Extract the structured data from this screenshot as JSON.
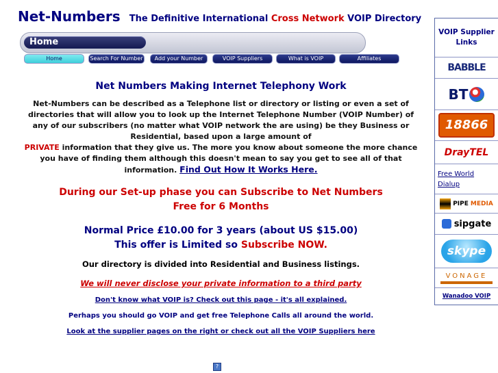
{
  "header": {
    "brand": "Net-Numbers",
    "tagline_part1": "The Definitive International",
    "tagline_red": "Cross Network",
    "tagline_part2": "VOIP Directory"
  },
  "homebar": {
    "label": "Home"
  },
  "nav": [
    {
      "label": "Home",
      "active": true
    },
    {
      "label": "Search For Number",
      "active": false
    },
    {
      "label": "Add your Number",
      "active": false
    },
    {
      "label": "VOIP Suppliers",
      "active": false
    },
    {
      "label": "What is VOIP",
      "active": false
    },
    {
      "label": "Affiliates",
      "active": false
    }
  ],
  "main": {
    "heading": "Net Numbers Making Internet Telephony Work",
    "intro_part1": "Net-Numbers can be described as a Telephone list or directory or listing or even a set of directories that will allow you to look up the Internet Telephone Number (VOIP Number) of any of our subscribers (no matter what VOIP network the are using) be they Business or Residential, based upon a large amount of",
    "intro_red": "PRIVATE",
    "intro_part2": "information that they give us. The more you know about someone the more chance you have of finding them although this doesn't mean to say you get to see all of that information.",
    "intro_link": "Find Out How It Works Here.",
    "setup_line1": "During our Set-up phase you can Subscribe to Net Numbers",
    "setup_line2": "Free for 6 Months",
    "price_line1": "Normal Price £10.00 for 3 years (about US $15.00)",
    "price_line2_part1": "This offer is Limited so",
    "price_line2_red": "Subscribe NOW.",
    "directory_text": "Our directory is divided into Residential and Business listings.",
    "privacy_text": "We will never disclose your private information to a third party",
    "voip_link": "Don't know what VOIP is? Check out this page - it's all explained.",
    "free_calls_text": "Perhaps you should go VOIP and get free Telephone Calls all around the world.",
    "suppliers_link": "Look at the supplier pages on the right or check out all the VOIP Suppliers here"
  },
  "sidebar": {
    "title": "VOIP Supplier Links",
    "items": [
      {
        "name": "babble",
        "text": "BABBLE"
      },
      {
        "name": "bt",
        "text": "BT"
      },
      {
        "name": "18866",
        "text": "18866"
      },
      {
        "name": "draytel",
        "text": "DrayTEL"
      },
      {
        "name": "free-world-dialup",
        "text": "Free World Dialup"
      },
      {
        "name": "pipemedia",
        "text_part1": "PIPE",
        "text_part2": "MEDIA"
      },
      {
        "name": "sipgate",
        "text": "sipgate"
      },
      {
        "name": "skype",
        "text": "skype"
      },
      {
        "name": "vonage",
        "text": "VONAGE"
      },
      {
        "name": "wanadoo",
        "text": "Wanadoo VOIP"
      }
    ]
  },
  "colors": {
    "navy": "#000080",
    "red": "#cc0000",
    "nav_dark": "#0d1660",
    "nav_active": "#3ed0db"
  }
}
